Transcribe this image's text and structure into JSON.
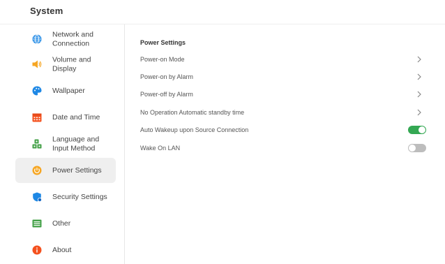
{
  "header": {
    "title": "System"
  },
  "sidebar": {
    "items": [
      {
        "label": "Network and\nConnection",
        "icon": "globe-icon",
        "color": "#1e88e5"
      },
      {
        "label": "Volume and\nDisplay",
        "icon": "speaker-icon",
        "color": "#f6a623"
      },
      {
        "label": "Wallpaper",
        "icon": "palette-icon",
        "color": "#1e88e5"
      },
      {
        "label": "Date and Time",
        "icon": "calendar-icon",
        "color": "#f4511e"
      },
      {
        "label": "Language and\nInput Method",
        "icon": "language-icon",
        "color": "#43a047"
      },
      {
        "label": "Power Settings",
        "icon": "power-icon",
        "color": "#f6a623"
      },
      {
        "label": "Security Settings",
        "icon": "shield-icon",
        "color": "#1e88e5"
      },
      {
        "label": "Other",
        "icon": "list-icon",
        "color": "#43a047"
      },
      {
        "label": "About",
        "icon": "info-icon",
        "color": "#f4511e"
      }
    ],
    "selected": "Power Settings"
  },
  "main": {
    "section_title": "Power Settings",
    "rows": [
      {
        "label": "Power-on Mode",
        "control": "chevron"
      },
      {
        "label": "Power-on by Alarm",
        "control": "chevron"
      },
      {
        "label": "Power-off by Alarm",
        "control": "chevron"
      },
      {
        "label": "No Operation Automatic standby time",
        "control": "chevron"
      },
      {
        "label": "Auto Wakeup upon Source Connection",
        "control": "toggle",
        "on": true
      },
      {
        "label": "Wake On LAN",
        "control": "toggle",
        "on": false
      }
    ]
  },
  "colors": {
    "accent_on": "#34a853",
    "toggle_off": "#bdbdbd",
    "selected_bg": "#efefef"
  }
}
